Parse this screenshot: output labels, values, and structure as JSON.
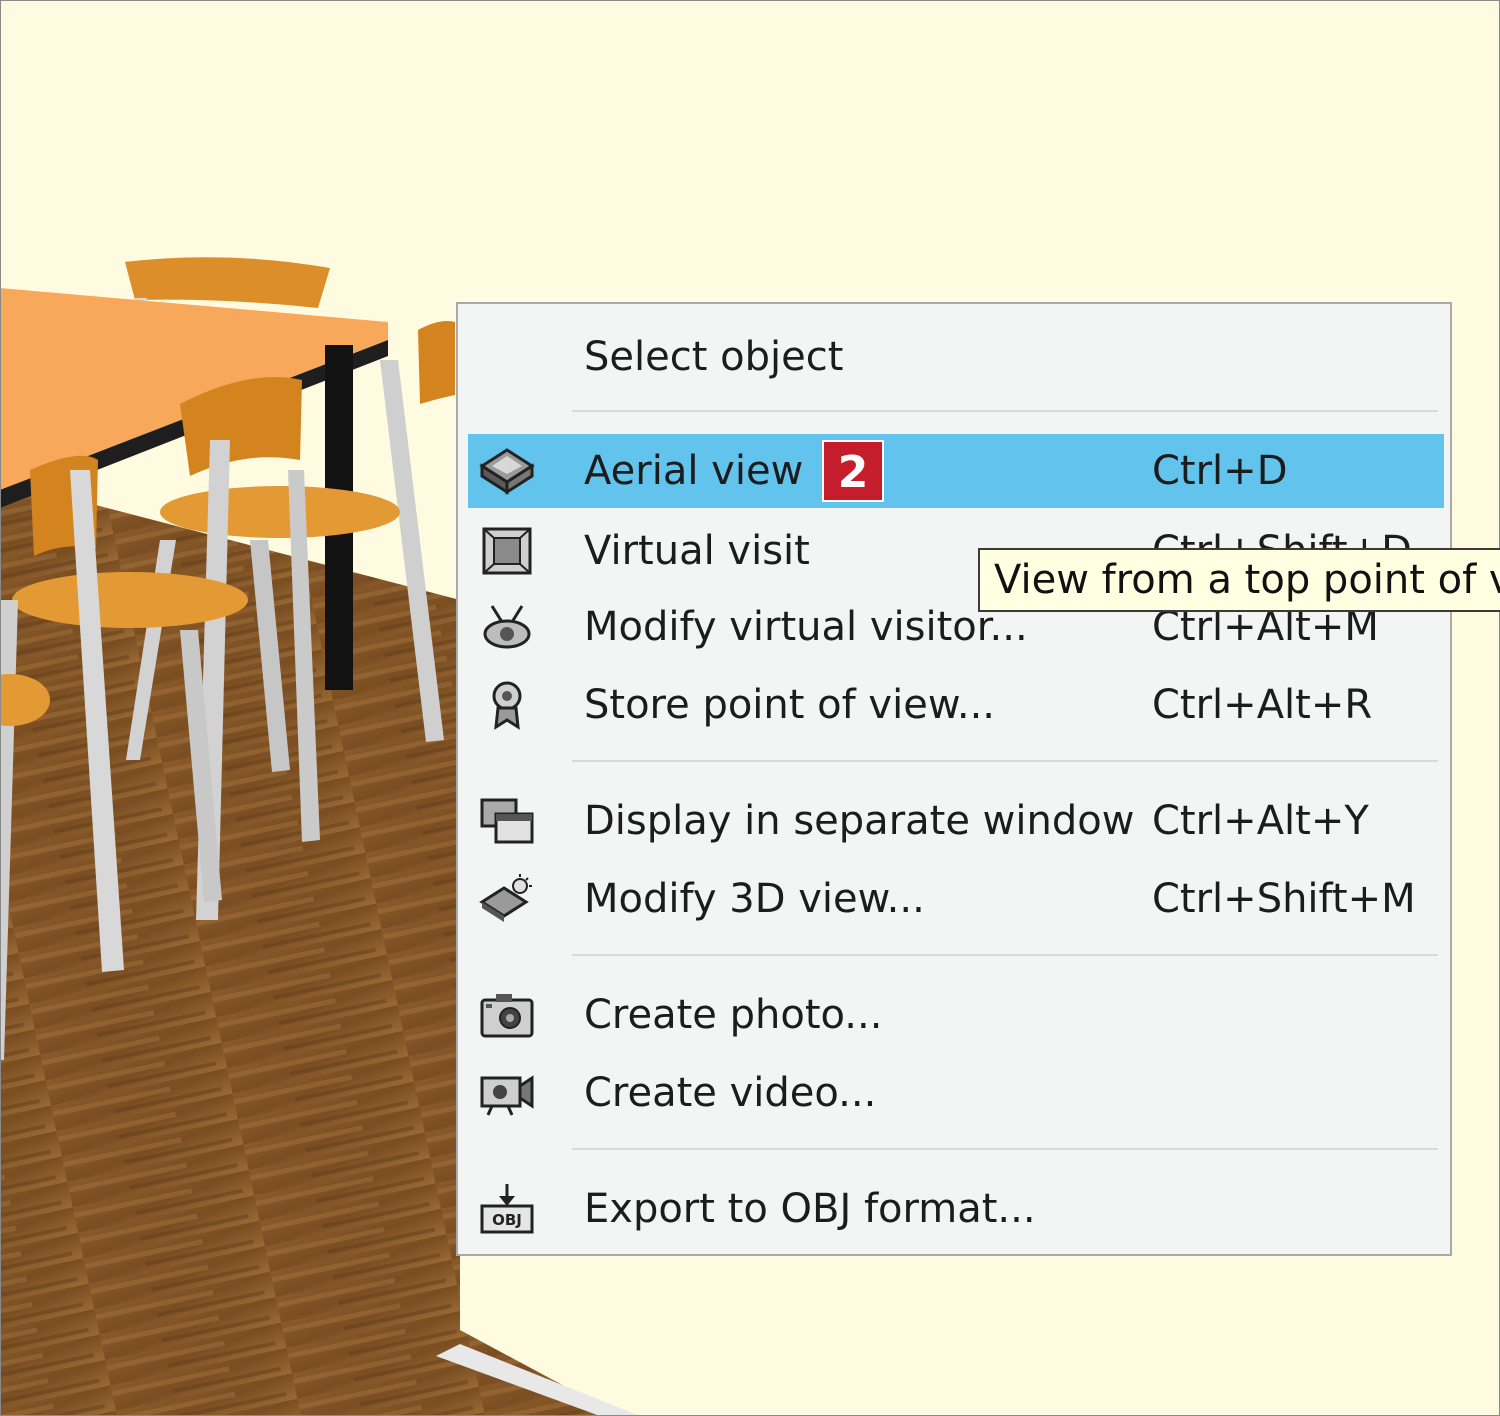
{
  "menu": {
    "items": [
      {
        "label": "Select object",
        "shortcut": "",
        "icon": "none"
      },
      {
        "label": "Aerial view",
        "shortcut": "Ctrl+D",
        "icon": "aerial-view-icon",
        "highlighted": true
      },
      {
        "label": "Virtual visit",
        "shortcut": "Ctrl+Shift+D",
        "icon": "virtual-visit-icon"
      },
      {
        "label": "Modify virtual visitor...",
        "shortcut": "Ctrl+Alt+M",
        "icon": "visitor-icon"
      },
      {
        "label": "Store point of view...",
        "shortcut": "Ctrl+Alt+R",
        "icon": "point-of-view-icon"
      },
      {
        "label": "Display in separate window",
        "shortcut": "Ctrl+Alt+Y",
        "icon": "separate-window-icon"
      },
      {
        "label": "Modify 3D view...",
        "shortcut": "Ctrl+Shift+M",
        "icon": "modify-3d-view-icon"
      },
      {
        "label": "Create photo...",
        "shortcut": "",
        "icon": "camera-icon"
      },
      {
        "label": "Create video...",
        "shortcut": "",
        "icon": "video-camera-icon"
      },
      {
        "label": "Export to OBJ format...",
        "shortcut": "",
        "icon": "export-obj-icon"
      }
    ]
  },
  "badge": {
    "text": "2"
  },
  "tooltip": {
    "text": "View from a top point of view"
  },
  "icons": {
    "export_obj_text": "OBJ"
  },
  "colors": {
    "highlight": "#62c3ec",
    "badge": "#c61d2d",
    "tooltip_bg": "#ffffe1",
    "background": "#fffbe0"
  }
}
